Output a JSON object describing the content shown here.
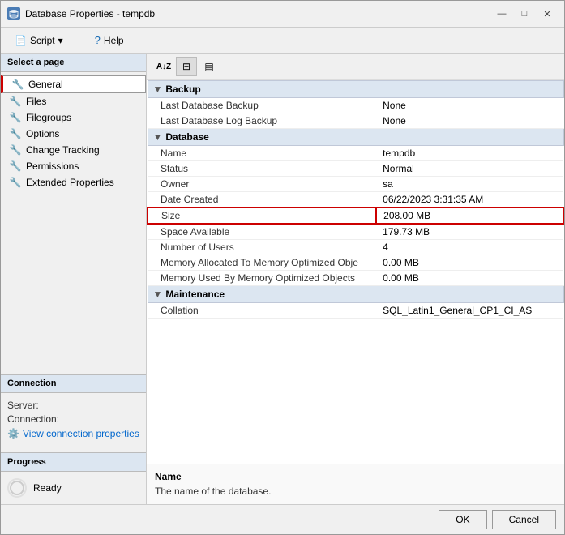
{
  "window": {
    "title": "Database Properties - tempdb",
    "icon": "db-icon"
  },
  "titlebar": {
    "minimize": "—",
    "maximize": "□",
    "close": "✕"
  },
  "toolbar": {
    "script_label": "Script",
    "help_label": "Help",
    "dropdown_icon": "▾"
  },
  "sidebar": {
    "header": "Select a page",
    "items": [
      {
        "label": "General",
        "active": true
      },
      {
        "label": "Files",
        "active": false
      },
      {
        "label": "Filegroups",
        "active": false
      },
      {
        "label": "Options",
        "active": false
      },
      {
        "label": "Change Tracking",
        "active": false
      },
      {
        "label": "Permissions",
        "active": false
      },
      {
        "label": "Extended Properties",
        "active": false
      }
    ],
    "connection_section": {
      "header": "Connection",
      "server_label": "Server:",
      "server_value": "",
      "connection_label": "Connection:",
      "connection_value": "",
      "view_link": "View connection properties"
    },
    "progress_section": {
      "header": "Progress",
      "status": "Ready"
    }
  },
  "prop_toolbar": {
    "sort_alpha_icon": "AZ↓",
    "sort_cat_icon": "⊞",
    "custom_icon": "□"
  },
  "sections": [
    {
      "name": "Backup",
      "rows": [
        {
          "name": "Last Database Backup",
          "value": "None"
        },
        {
          "name": "Last Database Log Backup",
          "value": "None"
        }
      ]
    },
    {
      "name": "Database",
      "rows": [
        {
          "name": "Name",
          "value": "tempdb"
        },
        {
          "name": "Status",
          "value": "Normal"
        },
        {
          "name": "Owner",
          "value": "sa"
        },
        {
          "name": "Date Created",
          "value": "06/22/2023 3:31:35 AM"
        },
        {
          "name": "Size",
          "value": "208.00 MB",
          "highlighted": true
        },
        {
          "name": "Space Available",
          "value": "179.73 MB"
        },
        {
          "name": "Number of Users",
          "value": "4"
        },
        {
          "name": "Memory Allocated To Memory Optimized Obje",
          "value": "0.00 MB"
        },
        {
          "name": "Memory Used By Memory Optimized Objects",
          "value": "0.00 MB"
        }
      ]
    },
    {
      "name": "Maintenance",
      "rows": [
        {
          "name": "Collation",
          "value": "SQL_Latin1_General_CP1_CI_AS"
        }
      ]
    }
  ],
  "description": {
    "title": "Name",
    "text": "The name of the database."
  },
  "footer": {
    "ok_label": "OK",
    "cancel_label": "Cancel"
  }
}
